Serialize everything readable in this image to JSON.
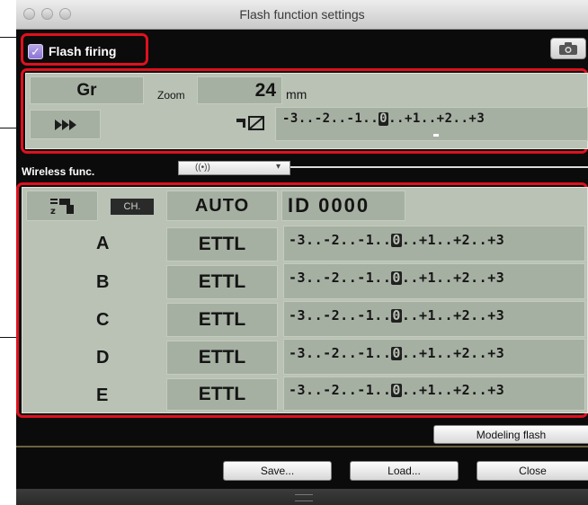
{
  "window": {
    "title": "Flash function settings"
  },
  "flash_firing": {
    "label": "Flash firing",
    "checked": true,
    "check_glyph": "✓"
  },
  "top_panel": {
    "mode": "Gr",
    "zoom_label": "Zoom",
    "zoom_value": "24",
    "zoom_unit": "mm",
    "shutter_sync_glyph": "⏵⏵|",
    "flash_comp_icon": "flash-exposure-compensation-icon",
    "scale": {
      "m3": "-3",
      "m2": "-2",
      "m1": "-1",
      "zero": "0",
      "p1": "+1",
      "p2": "+2",
      "p3": "+3"
    }
  },
  "wireless": {
    "label": "Wireless func.",
    "selected_glyph": "((•))",
    "options_icon": "dropdown-arrow-icon"
  },
  "wireless_panel": {
    "ch_label": "CH.",
    "channel": "AUTO",
    "id_label": "ID",
    "id_value": "0000",
    "groups": [
      {
        "name": "A",
        "mode": "ETTL"
      },
      {
        "name": "B",
        "mode": "ETTL"
      },
      {
        "name": "C",
        "mode": "ETTL"
      },
      {
        "name": "D",
        "mode": "ETTL"
      },
      {
        "name": "E",
        "mode": "ETTL"
      }
    ],
    "scale": {
      "m3": "-3",
      "m2": "-2",
      "m1": "-1",
      "zero": "0",
      "p1": "+1",
      "p2": "+2",
      "p3": "+3"
    }
  },
  "buttons": {
    "modeling_flash": "Modeling flash",
    "save": "Save...",
    "load": "Load...",
    "close": "Close"
  },
  "colors": {
    "lcd": "#b9c2b5",
    "cell": "#a6b0a2",
    "highlight": "#e0101e",
    "window": "#0b0b0b"
  }
}
